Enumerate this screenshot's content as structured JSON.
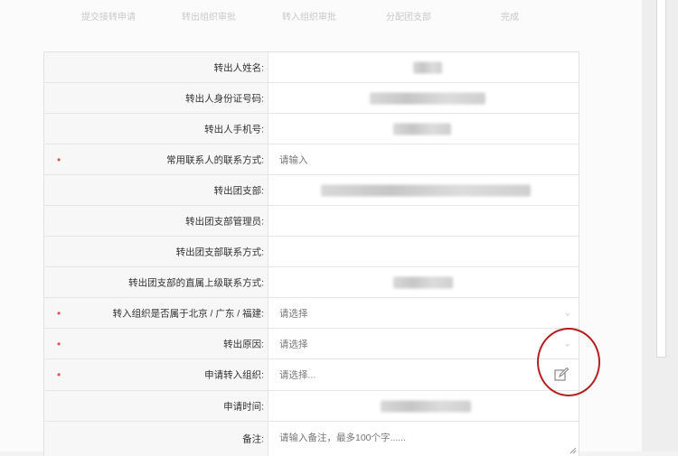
{
  "steps": [
    "提交接转申请",
    "转出组织审批",
    "转入组织审批",
    "分配团支部",
    "完成"
  ],
  "form": {
    "rows": [
      {
        "label": "转出人姓名:",
        "required": false,
        "value": "",
        "placeholder": "",
        "blurred": true,
        "control": "text"
      },
      {
        "label": "转出人身份证号码:",
        "required": false,
        "value": "",
        "placeholder": "",
        "blurred": true,
        "control": "text"
      },
      {
        "label": "转出人手机号:",
        "required": false,
        "value": "",
        "placeholder": "",
        "blurred": true,
        "control": "text"
      },
      {
        "label": "常用联系人的联系方式:",
        "required": true,
        "value": "",
        "placeholder": "请输入",
        "blurred": false,
        "control": "input"
      },
      {
        "label": "转出团支部:",
        "required": false,
        "value": "",
        "placeholder": "",
        "blurred": true,
        "control": "text"
      },
      {
        "label": "转出团支部管理员:",
        "required": false,
        "value": "",
        "placeholder": "",
        "blurred": false,
        "control": "text"
      },
      {
        "label": "转出团支部联系方式:",
        "required": false,
        "value": "",
        "placeholder": "",
        "blurred": false,
        "control": "text"
      },
      {
        "label": "转出团支部的直属上级联系方式:",
        "required": false,
        "value": "",
        "placeholder": "",
        "blurred": true,
        "control": "text"
      },
      {
        "label": "转入组织是否属于北京 / 广东 / 福建:",
        "required": true,
        "value": "",
        "placeholder": "请选择",
        "blurred": false,
        "control": "select"
      },
      {
        "label": "转出原因:",
        "required": true,
        "value": "",
        "placeholder": "请选择",
        "blurred": false,
        "control": "select"
      },
      {
        "label": "申请转入组织:",
        "required": true,
        "value": "",
        "placeholder": "请选择...",
        "blurred": false,
        "control": "picker"
      },
      {
        "label": "申请时间:",
        "required": false,
        "value": "",
        "placeholder": "",
        "blurred": true,
        "control": "text"
      },
      {
        "label": "备注:",
        "required": false,
        "value": "",
        "placeholder": "请输入备注，最多100个字......",
        "blurred": false,
        "control": "textarea"
      }
    ],
    "required_mark": "•"
  },
  "icons": {
    "select_arrow": "chevron-down-icon",
    "picker": "edit-icon",
    "resize": "resize-handle-icon"
  },
  "colors": {
    "required_mark": "#d9534f",
    "annotation_circle": "#b51f1f",
    "label_background": "#f7f7f7",
    "step_text": "#c9c9c9"
  }
}
